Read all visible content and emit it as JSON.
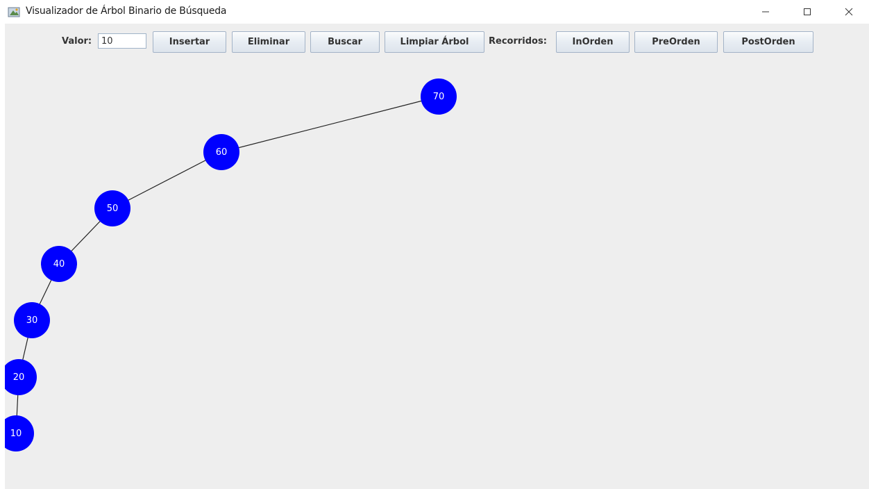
{
  "window": {
    "title": "Visualizador de Árbol Binario de Búsqueda",
    "icon": "java-duke-icon",
    "controls": [
      "minimize-icon",
      "maximize-icon",
      "close-icon"
    ]
  },
  "toolbar": {
    "valor_label": "Valor:",
    "valor_input": "10",
    "insertar_label": "Insertar",
    "eliminar_label": "Eliminar",
    "buscar_label": "Buscar",
    "limpiar_label": "Limpiar Árbol",
    "recorridos_label": "Recorridos:",
    "inorden_label": "InOrden",
    "preorden_label": "PreOrden",
    "postorden_label": "PostOrden"
  },
  "tree": {
    "node_color": "#0000ff",
    "node_text_color": "#ffffff",
    "edge_color": "#222222",
    "nodes": [
      "70",
      "60",
      "50",
      "40",
      "30",
      "20",
      "10"
    ]
  }
}
